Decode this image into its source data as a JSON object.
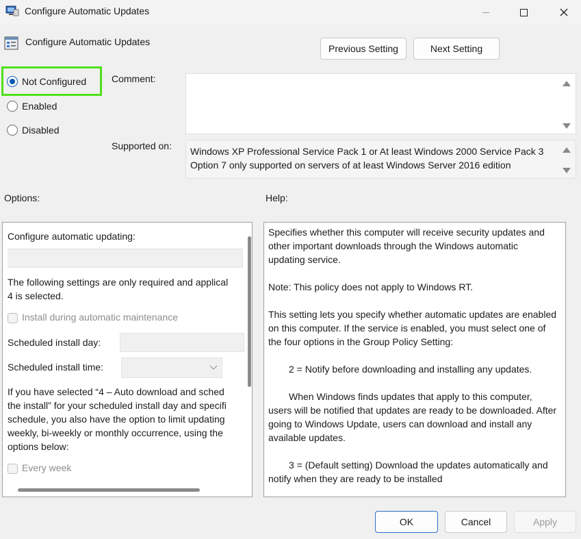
{
  "window": {
    "title": "Configure Automatic Updates"
  },
  "header": {
    "policy_title": "Configure Automatic Updates",
    "previous_label": "Previous Setting",
    "next_label": "Next Setting"
  },
  "state": {
    "not_configured": "Not Configured",
    "enabled": "Enabled",
    "disabled": "Disabled",
    "selected": "Not Configured"
  },
  "comment": {
    "label": "Comment:",
    "value": ""
  },
  "supported": {
    "label": "Supported on:",
    "line1": "Windows XP Professional Service Pack 1 or At least Windows 2000 Service Pack 3",
    "line2": "Option 7 only supported on servers of at least Windows Server 2016 edition"
  },
  "options": {
    "label": "Options:",
    "configure_label": "Configure automatic updating:",
    "note_line1": "The following settings are only required and applical",
    "note_line2": "4 is selected.",
    "install_maintenance": "Install during automatic maintenance",
    "install_day_label": "Scheduled install day:",
    "install_time_label": "Scheduled install time:",
    "para_line1": "If you have selected “4 – Auto download and sched",
    "para_line2": "the install” for your scheduled install day and specifi",
    "para_line3": "schedule, you also have the option to limit updating",
    "para_line4": "weekly, bi-weekly or monthly occurrence, using the",
    "para_line5": "options below:",
    "every_week": "Every week"
  },
  "help": {
    "label": "Help:",
    "p1": "Specifies whether this computer will receive security updates and other important downloads through the Windows automatic updating service.",
    "p2": "Note: This policy does not apply to Windows RT.",
    "p3": "This setting lets you specify whether automatic updates are enabled on this computer. If the service is enabled, you must select one of the four options in the Group Policy Setting:",
    "p4": "2 = Notify before downloading and installing any updates.",
    "p5": "When Windows finds updates that apply to this computer, users will be notified that updates are ready to be downloaded. After going to Windows Update, users can download and install any available updates.",
    "p6": "3 = (Default setting) Download the updates automatically and notify when they are ready to be installed"
  },
  "footer": {
    "ok_label": "OK",
    "cancel_label": "Cancel",
    "apply_label": "Apply"
  },
  "colors": {
    "highlight": "#4fe01c",
    "accent": "#0c5bb5"
  }
}
